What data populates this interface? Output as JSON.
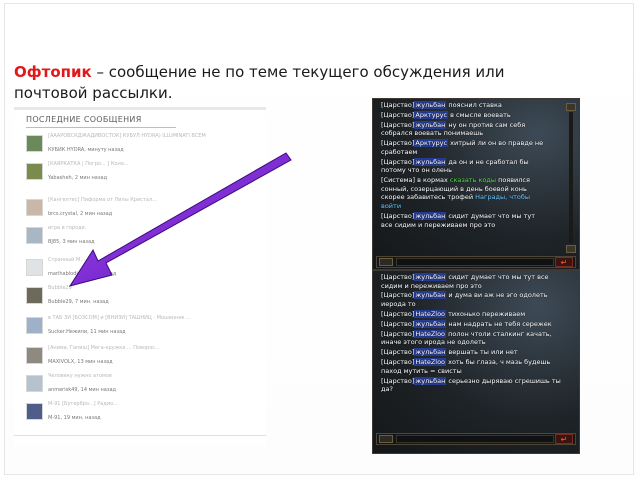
{
  "heading": {
    "term": "Офтопик",
    "text": " – сообщение не по теме текущего обсуждения или почтовой рассылки."
  },
  "forum": {
    "title": "ПОСЛЕДНИЕ СООБЩЕНИЯ",
    "entries": [
      {
        "text": "[АААРОВСКДЖАДИВОСТОК] КУБУЛ HYDRA) ILLUMINATI ВСЕМ",
        "author": "КУБИК HYDRA, минуту назад"
      },
      {
        "text": "[КАЯРКАТКА | Погро... ] Коно... ",
        "author": "Yabasheh, 2 мин назад"
      },
      {
        "text": "[Кангелтес] Пиформа от Лилы Кристал...",
        "author": "brcs.crystal, 2 мин назад"
      },
      {
        "text": "игра в городе.",
        "author": "BJ85, 3 мин назад"
      },
      {
        "text": "Странный М...",
        "author": "marihablodi... 3 мин назад"
      },
      {
        "text": "Bubble29",
        "author": "Bubble29, 7 мин. назад"
      },
      {
        "text": "в ТАБ ЗИ [БОЗСОМ] и [ВНИЗИ] ТАШНИЦ - Мошенник ...",
        "author": "Sucker.Нежили, 11 мин назад"
      },
      {
        "text": "[Анима, Гапиш] Мега-кружка ... Поворос...",
        "author": "MAXIVOLX, 13 мин назад"
      },
      {
        "text": "Человеку нужно атомов",
        "author": "anmerisk49, 14 мин назад"
      },
      {
        "text": "М-91 [Бутербро...] Радио...",
        "author": "М-91, 19 мин. назад"
      }
    ]
  },
  "chat1": {
    "lines": [
      {
        "pre": "[Царство]",
        "name": "жульбан",
        "post": " пояснил ставка"
      },
      {
        "pre": "[Царство]",
        "name": "Арктурус",
        "post": " в смысле воевать"
      },
      {
        "pre": "[Царство]",
        "name": "жульбан",
        "post": " ну он против сам себя собрался воевать понимаешь"
      },
      {
        "pre": "[Царство]",
        "name": "Арктурус",
        "post": " хитрый ли он во правде не сработаем"
      },
      {
        "pre": "[Царство]",
        "name": "жульбан",
        "post": " да он и не сработал бы потому что он олень"
      },
      {
        "pre": "[Система] в кормах ",
        "green": "сказать коды",
        "post": " появился сонный, созерцающий в день боевой конь скорее забавитесь трофей ",
        "link": "Награды, чтобы войти"
      },
      {
        "pre": "[Царство]",
        "name": "жульбан",
        "post": " сидит думает что мы тут все сидим и переживаем про это"
      }
    ]
  },
  "chat2": {
    "lines": [
      {
        "pre": "[Царство]",
        "name": "жульбан",
        "post": " сидит думает что мы тут все сидим и переживаем про это"
      },
      {
        "pre": "[Царство]",
        "name": "жульбан",
        "post": " и дума ви аж не эго одолеть иерода то"
      },
      {
        "pre": "[Царство]",
        "name": "HateZloo",
        "post": " тихонько переживаем"
      },
      {
        "pre": "[Царство]",
        "name": "жульбан",
        "post": " нам надрать не тебя сережек"
      },
      {
        "pre": "[Царство]",
        "name": "HateZloo",
        "post": " полон чтоли сталкинг качать, иначе этого ирода не одолеть"
      },
      {
        "pre": "[Царство]",
        "name": "жульбан",
        "post": " вершать ты или нет"
      },
      {
        "pre": "[Царство]",
        "name": "HateZloo",
        "post": " хоть бы глаза, ч мазь будешь паход мутить = свисты"
      },
      {
        "pre": "[Царство]",
        "name": "жульбан",
        "post": " серьезно дыряваю сгрешишь ты да?"
      }
    ]
  },
  "icons": {
    "enter": "↵",
    "scroll_up": "▲",
    "scroll_down": "▼"
  },
  "colors": {
    "term": "#e0181b",
    "arrow": "#7a1fd6",
    "name_highlight": "#253b93"
  }
}
